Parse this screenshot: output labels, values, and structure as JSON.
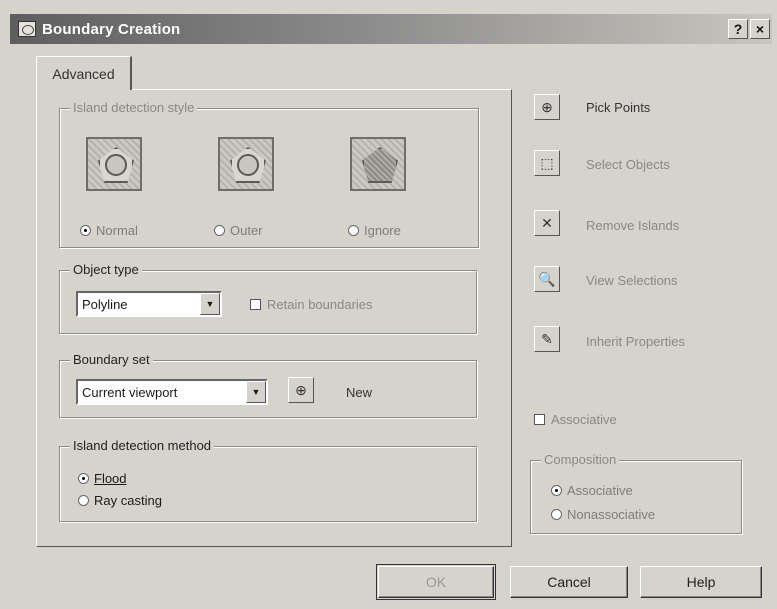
{
  "window": {
    "title": "Boundary Creation",
    "help_glyph": "?",
    "close_glyph": "×"
  },
  "tabs": [
    {
      "label": "Advanced"
    }
  ],
  "island_detection_style": {
    "legend": "Island detection style",
    "previews": [
      "normal-preview-icon",
      "outer-preview-icon",
      "ignore-preview-icon"
    ],
    "options": [
      {
        "label": "Normal",
        "selected": true
      },
      {
        "label": "Outer",
        "selected": false
      },
      {
        "label": "Ignore",
        "selected": false
      }
    ]
  },
  "object_type": {
    "legend": "Object type",
    "value": "Polyline",
    "retain_label": "Retain boundaries",
    "retain_checked": false
  },
  "boundary_set": {
    "legend": "Boundary set",
    "value": "Current viewport",
    "new_label": "New"
  },
  "island_detection_method": {
    "legend": "Island detection method",
    "options": [
      {
        "label": "Flood",
        "selected": true
      },
      {
        "label": "Ray casting",
        "selected": false
      }
    ]
  },
  "side_actions": [
    {
      "label": "Pick Points",
      "icon": "pick-points-icon",
      "glyph": "⊕",
      "enabled": true
    },
    {
      "label": "Select Objects",
      "icon": "select-objects-icon",
      "glyph": "⬚",
      "enabled": false
    },
    {
      "label": "Remove Islands",
      "icon": "remove-islands-icon",
      "glyph": "✕",
      "enabled": false
    },
    {
      "label": "View Selections",
      "icon": "view-selections-icon",
      "glyph": "🔍",
      "enabled": false
    },
    {
      "label": "Inherit Properties",
      "icon": "inherit-properties-icon",
      "glyph": "✎",
      "enabled": false
    }
  ],
  "associative": {
    "label": "Associative",
    "checked": false
  },
  "composition": {
    "legend": "Composition",
    "options": [
      {
        "label": "Associative",
        "selected": true
      },
      {
        "label": "Nonassociative",
        "selected": false
      }
    ]
  },
  "footer": {
    "ok": "OK",
    "cancel": "Cancel",
    "help": "Help"
  },
  "colors": {
    "dialog_bg": "#d6d3cc",
    "title_start": "#5e5e5e",
    "disabled_text": "#8a8882"
  }
}
